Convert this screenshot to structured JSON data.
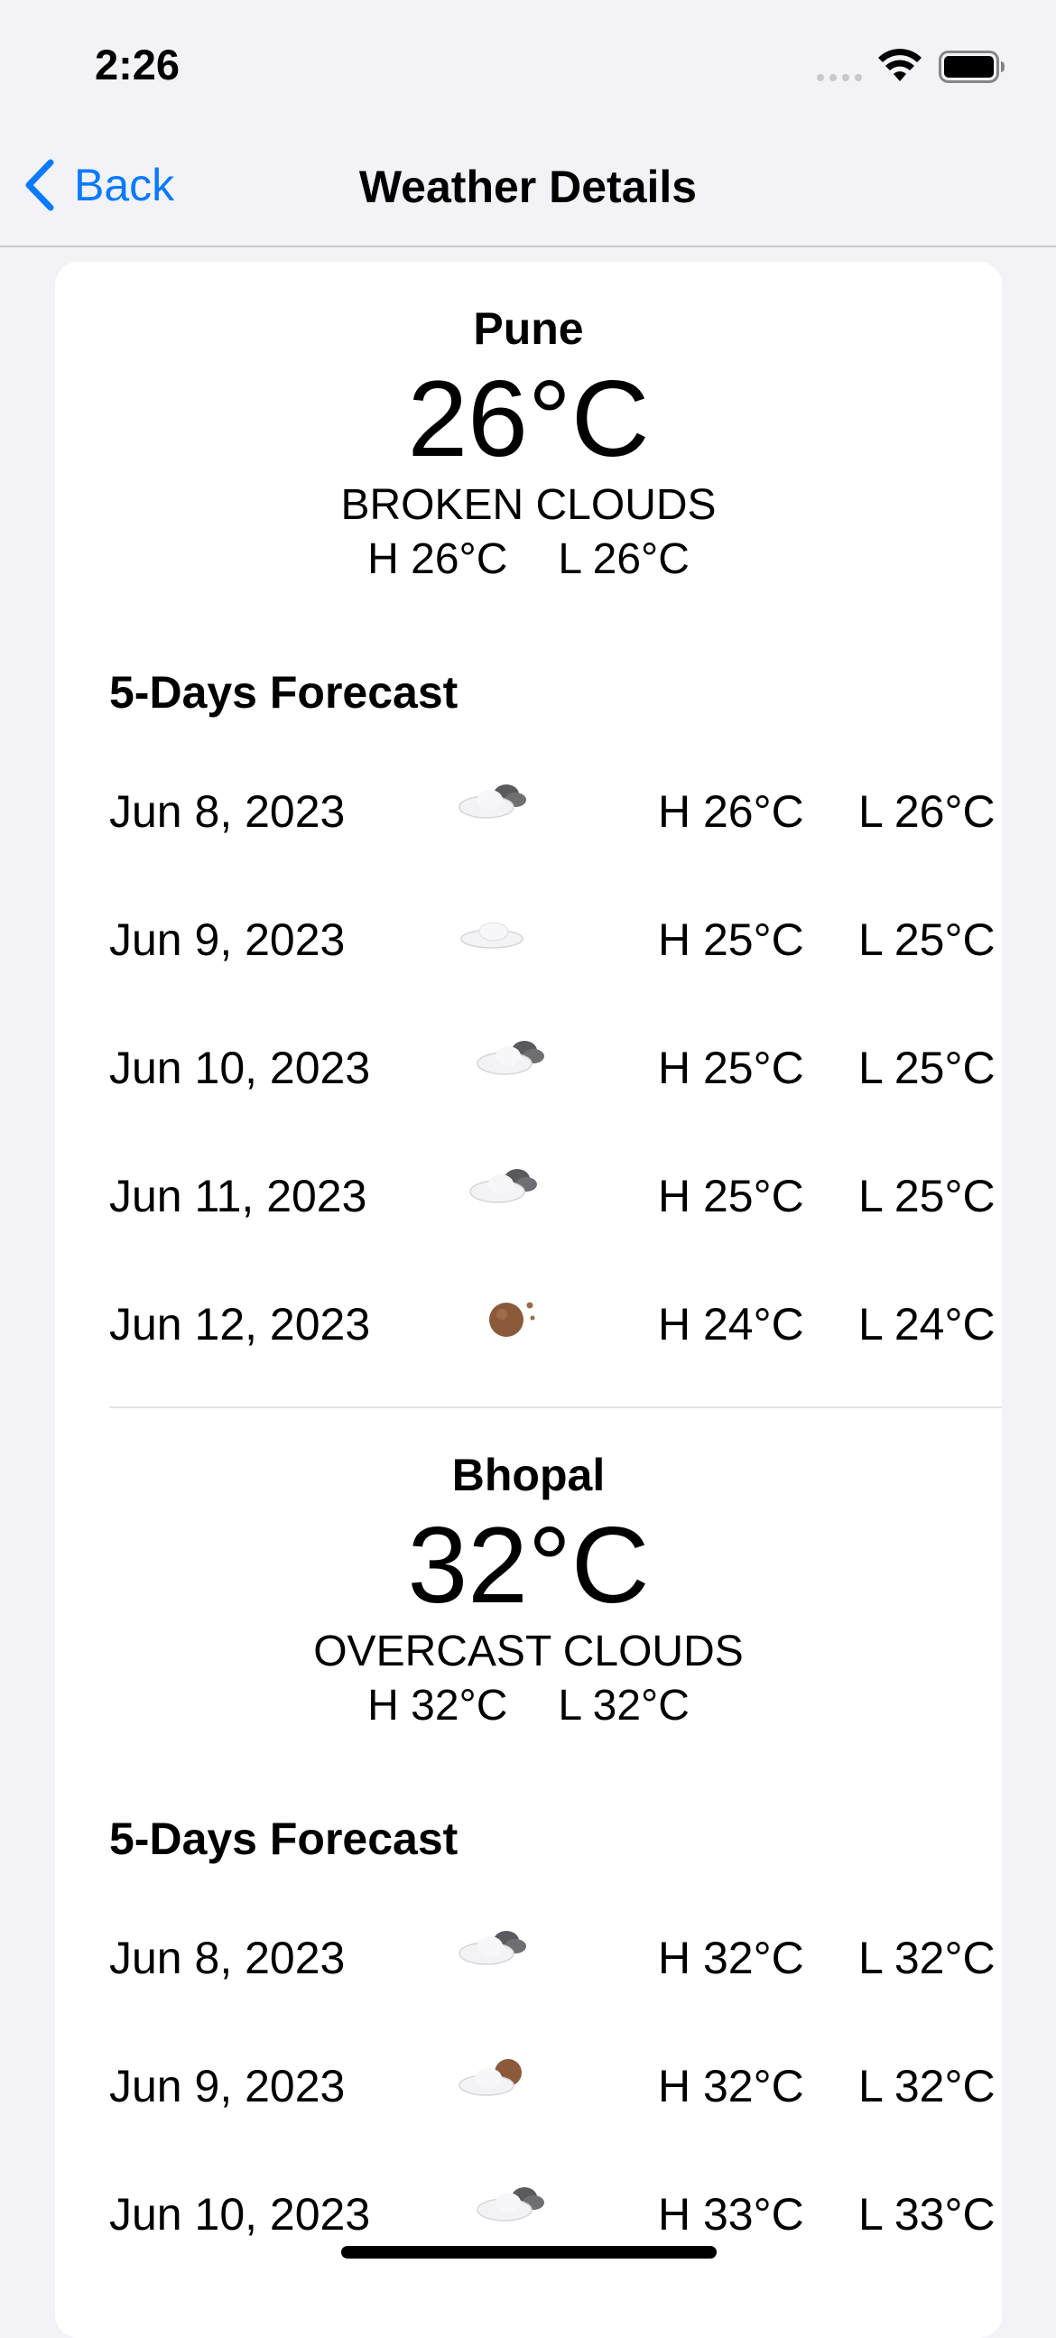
{
  "status_bar": {
    "time": "2:26"
  },
  "nav": {
    "back_label": "Back",
    "title": "Weather Details"
  },
  "cities": [
    {
      "name": "Pune",
      "temp": "26°C",
      "description": "BROKEN CLOUDS",
      "high": "H 26°C",
      "low": "L 26°C",
      "forecast_title": "5-Days Forecast",
      "forecast": [
        {
          "date": "Jun 8, 2023",
          "icon": "cloud-dark-cloud-icon",
          "high": "H 26°C",
          "low": "L 26°C"
        },
        {
          "date": "Jun 9, 2023",
          "icon": "cloud-icon",
          "high": "H 25°C",
          "low": "L 25°C"
        },
        {
          "date": "Jun 10, 2023",
          "icon": "cloud-dark-cloud-icon",
          "high": "H 25°C",
          "low": "L 25°C"
        },
        {
          "date": "Jun 11, 2023",
          "icon": "cloud-dark-cloud-icon",
          "high": "H 25°C",
          "low": "L 25°C"
        },
        {
          "date": "Jun 12, 2023",
          "icon": "moon-icon",
          "high": "H 24°C",
          "low": "L 24°C"
        }
      ]
    },
    {
      "name": "Bhopal",
      "temp": "32°C",
      "description": "OVERCAST CLOUDS",
      "high": "H 32°C",
      "low": "L 32°C",
      "forecast_title": "5-Days Forecast",
      "forecast": [
        {
          "date": "Jun 8, 2023",
          "icon": "cloud-dark-cloud-icon",
          "high": "H 32°C",
          "low": "L 32°C"
        },
        {
          "date": "Jun 9, 2023",
          "icon": "cloud-moon-icon",
          "high": "H 32°C",
          "low": "L 32°C"
        },
        {
          "date": "Jun 10, 2023",
          "icon": "cloud-dark-cloud-icon",
          "high": "H 33°C",
          "low": "L 33°C"
        }
      ]
    }
  ],
  "colors": {
    "accent": "#0a7aff",
    "background": "#f2f2f7",
    "card": "#ffffff"
  }
}
